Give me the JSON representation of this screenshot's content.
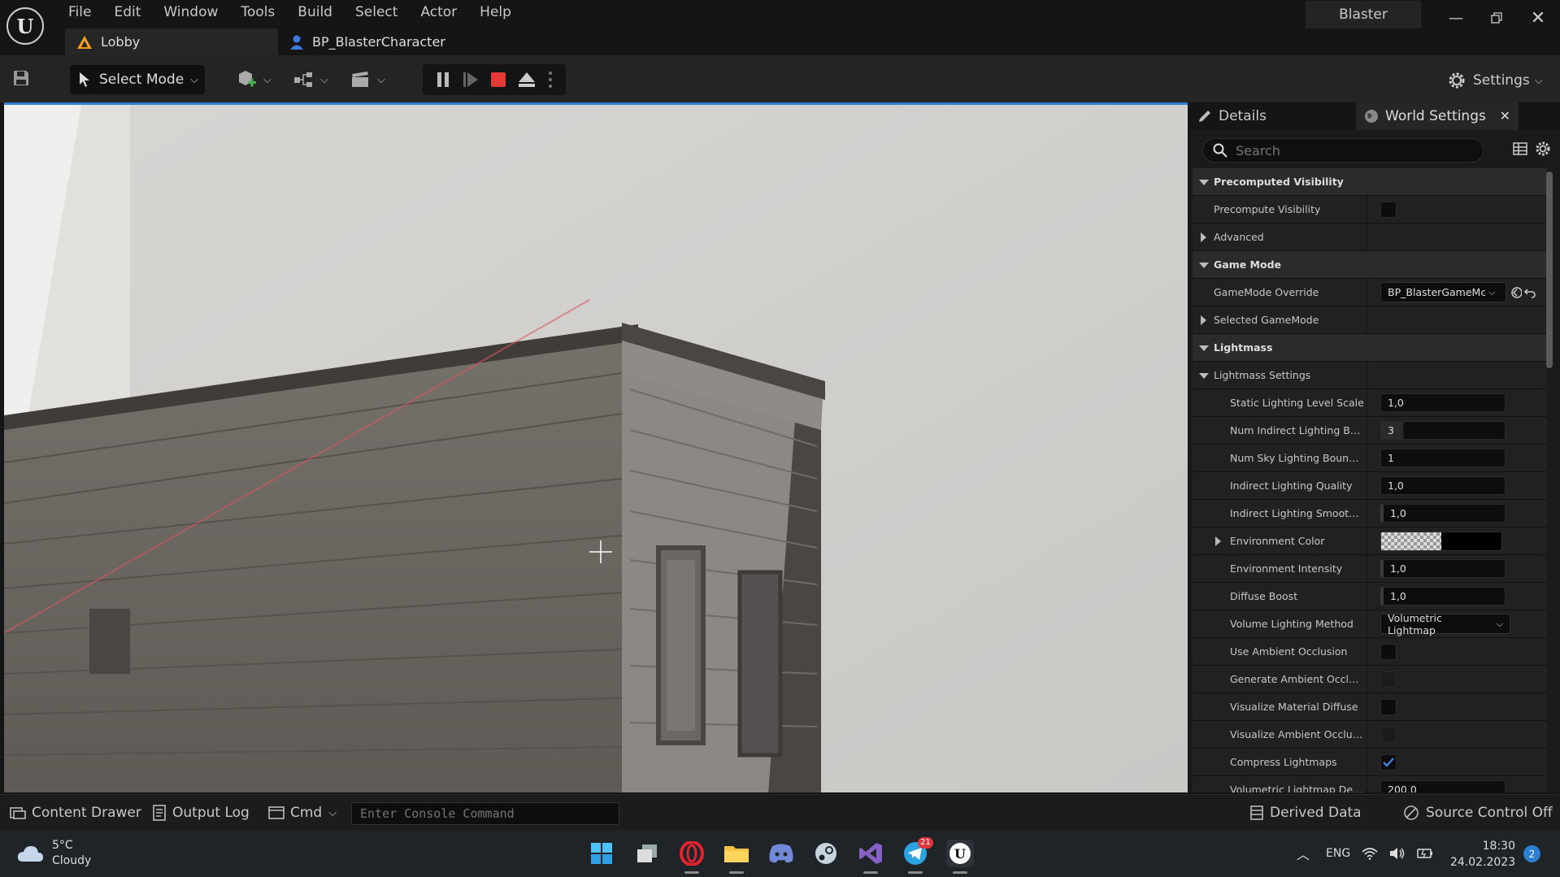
{
  "menu": [
    "File",
    "Edit",
    "Window",
    "Tools",
    "Build",
    "Select",
    "Actor",
    "Help"
  ],
  "tabs": {
    "level": "Lobby",
    "blueprint": "BP_BlasterCharacter"
  },
  "project_name": "Blaster",
  "toolbar": {
    "select_mode": "Select Mode",
    "settings": "Settings"
  },
  "details": {
    "tab_details": "Details",
    "tab_world": "World Settings",
    "search_placeholder": "Search",
    "rows": {
      "cat_precomputed": "Precomputed Visibility",
      "precompute_visibility": "Precompute Visibility",
      "advanced": "Advanced",
      "cat_game_mode": "Game Mode",
      "gamemode_override": "GameMode Override",
      "gamemode_override_value": "BP_BlasterGameMc",
      "selected_gamemode": "Selected GameMode",
      "cat_lightmass": "Lightmass",
      "lightmass_settings": "Lightmass Settings",
      "static_lighting_level_scale": "Static Lighting Level Scale",
      "static_lighting_level_scale_value": "1,0",
      "num_indirect_bounces": "Num Indirect Lighting Boun...",
      "num_indirect_bounces_value": "3",
      "num_sky_bounces": "Num Sky Lighting Bounces",
      "num_sky_bounces_value": "1",
      "indirect_quality": "Indirect Lighting Quality",
      "indirect_quality_value": "1,0",
      "indirect_smoothness": "Indirect Lighting Smoothne...",
      "indirect_smoothness_value": "1,0",
      "environment_color": "Environment Color",
      "environment_intensity": "Environment Intensity",
      "environment_intensity_value": "1,0",
      "diffuse_boost": "Diffuse Boost",
      "diffuse_boost_value": "1,0",
      "volume_lighting_method": "Volume Lighting Method",
      "volume_lighting_method_value": "Volumetric Lightmap",
      "use_ambient_occlusion": "Use Ambient Occlusion",
      "generate_ambient_occlusion": "Generate Ambient Occlusio...",
      "visualize_material_diffuse": "Visualize Material Diffuse",
      "visualize_ambient_occlusion": "Visualize Ambient Occlusion",
      "compress_lightmaps": "Compress Lightmaps",
      "volumetric_lightmap_detail": "Volumetric Lightmap Detail...",
      "volumetric_lightmap_detail_value": "200,0"
    }
  },
  "bottom": {
    "content_drawer": "Content Drawer",
    "output_log": "Output Log",
    "cmd": "Cmd",
    "console_placeholder": "Enter Console Command",
    "derived_data": "Derived Data",
    "source_control": "Source Control Off"
  },
  "taskbar": {
    "temperature": "5°C",
    "weather": "Cloudy",
    "language": "ENG",
    "time": "18:30",
    "date": "24.02.2023",
    "notifications": "2",
    "telegram_badge": "21"
  },
  "colors": {
    "accent": "#2f7fd6",
    "stop": "#e53935"
  }
}
